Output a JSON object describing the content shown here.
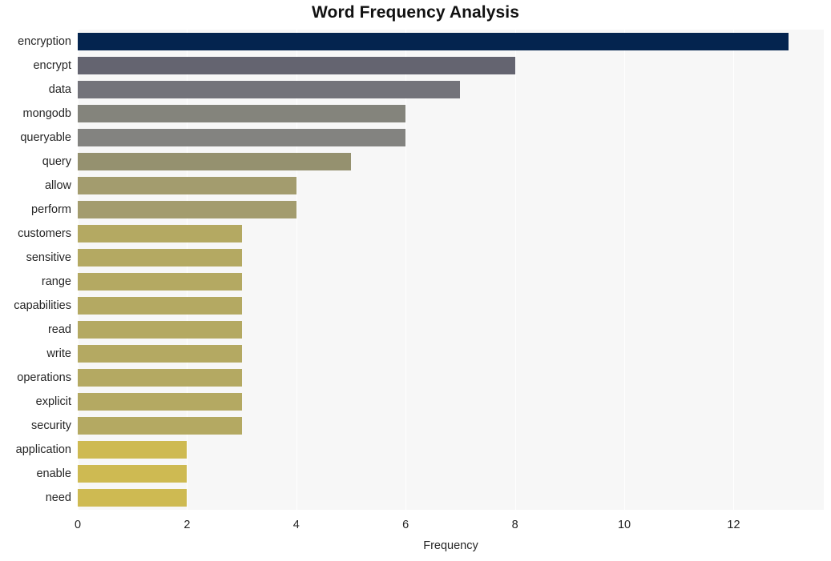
{
  "chart_data": {
    "type": "bar",
    "orientation": "horizontal",
    "title": "Word Frequency Analysis",
    "xlabel": "Frequency",
    "ylabel": "",
    "xlim": [
      0,
      13.65
    ],
    "xticks": [
      0,
      2,
      4,
      6,
      8,
      10,
      12
    ],
    "xtick_labels": [
      "0",
      "2",
      "4",
      "6",
      "8",
      "10",
      "12"
    ],
    "grid": "vertical-white-on-light-gray",
    "legend": "none",
    "categories": [
      "encryption",
      "encrypt",
      "data",
      "mongodb",
      "queryable",
      "query",
      "allow",
      "perform",
      "customers",
      "sensitive",
      "range",
      "capabilities",
      "read",
      "write",
      "operations",
      "explicit",
      "security",
      "application",
      "enable",
      "need"
    ],
    "values": [
      13,
      8,
      7,
      6,
      6,
      5,
      4,
      4,
      3,
      3,
      3,
      3,
      3,
      3,
      3,
      3,
      3,
      2,
      2,
      2
    ],
    "bar_colors": [
      "#04244f",
      "#646470",
      "#73737a",
      "#84847c",
      "#838380",
      "#95916f",
      "#a39c6e",
      "#a39c6e",
      "#b4a962",
      "#b4a962",
      "#b4a962",
      "#b4a962",
      "#b4a962",
      "#b4a962",
      "#b4a962",
      "#b4a962",
      "#b4a962",
      "#ceba52",
      "#ceba52",
      "#ceba52"
    ],
    "plot_bg": "#f7f7f7",
    "page_bg": "#ffffff",
    "title_color": "#111111",
    "tick_color": "#262626"
  }
}
